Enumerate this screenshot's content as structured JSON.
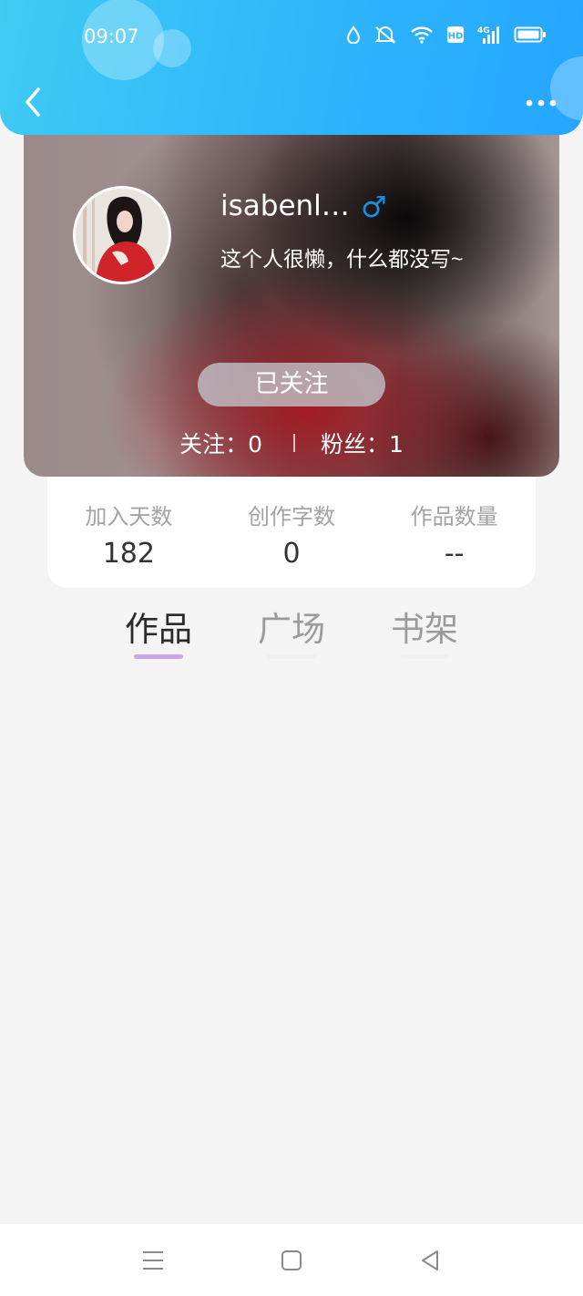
{
  "status_bar": {
    "time": "09:07",
    "icons": [
      "drop-icon",
      "mute-icon",
      "wifi-icon",
      "hd-icon",
      "signal-4g-icon",
      "battery-icon"
    ],
    "hd_label": "HD",
    "network_label": "4G"
  },
  "header": {
    "back_icon": "chevron-left-icon",
    "more_icon": "more-dots-icon"
  },
  "profile": {
    "username": "isabenl…",
    "gender_symbol": "♂",
    "bio": "这个人很懒，什么都没写~",
    "follow_button": "已关注",
    "following": "关注：0",
    "followers": "粉丝：1"
  },
  "stats": [
    {
      "label": "加入天数",
      "value": "182"
    },
    {
      "label": "创作字数",
      "value": "0"
    },
    {
      "label": "作品数量",
      "value": "--"
    }
  ],
  "tabs": [
    {
      "label": "作品",
      "active": true
    },
    {
      "label": "广场",
      "active": false
    },
    {
      "label": "书架",
      "active": false
    }
  ],
  "bottom_nav": [
    "menu-icon",
    "home-square-icon",
    "back-triangle-icon"
  ],
  "colors": {
    "header_gradient_start": "#3fcbf3",
    "header_gradient_end": "#25a6ff",
    "gender_blue": "#1b8de0",
    "tab_indicator": "#c9a8ea",
    "background": "#f4f4f4"
  }
}
